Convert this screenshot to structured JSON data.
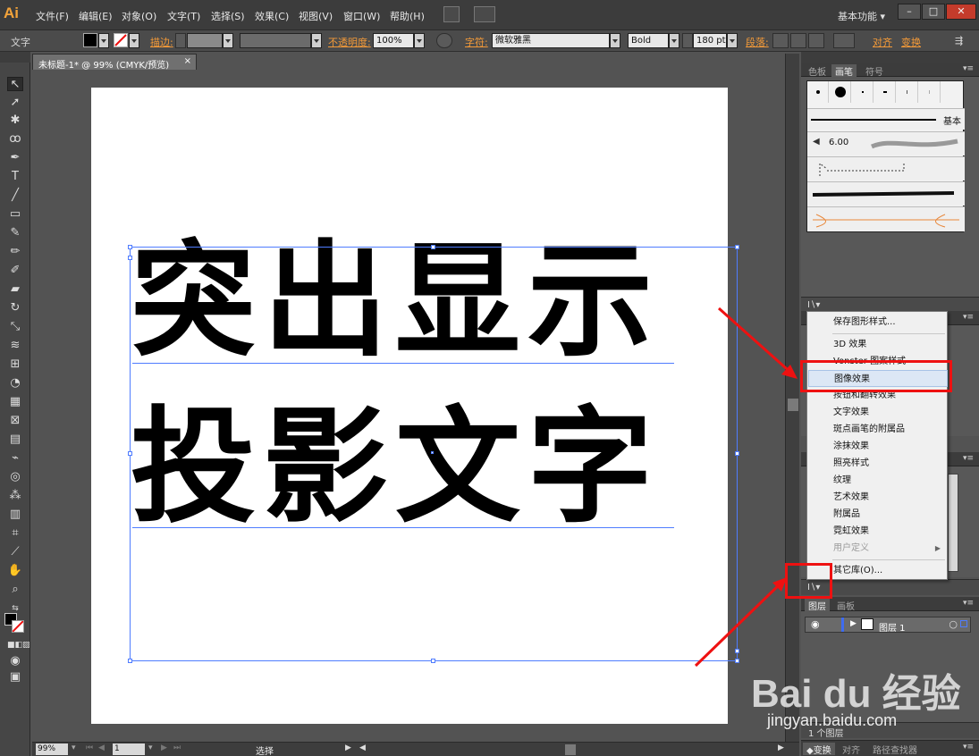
{
  "app": {
    "logo": "Ai",
    "workspace": "基本功能",
    "workspace_arrow": "▾"
  },
  "menu": [
    "文件(F)",
    "编辑(E)",
    "对象(O)",
    "文字(T)",
    "选择(S)",
    "效果(C)",
    "视图(V)",
    "窗口(W)",
    "帮助(H)"
  ],
  "window": {
    "min": "–",
    "restore": "□",
    "close": "✕"
  },
  "control_bar": {
    "tool_label": "文字",
    "stroke_label": "描边:",
    "opacity_label": "不透明度:",
    "opacity_value": "100%",
    "char_label": "字符:",
    "font_family": "微软雅黑",
    "font_style": "Bold",
    "font_size": "180 pt",
    "para_label": "段落:",
    "align_label": "对齐",
    "transform_label": "变换"
  },
  "document": {
    "tab_title": "未标题-1* @ 99% (CMYK/预览)",
    "tab_close": "×"
  },
  "canvas_text": {
    "line1": "突出显示",
    "line2": "投影文字"
  },
  "status": {
    "zoom": "99%",
    "page": "1",
    "mode": "选择"
  },
  "panels": {
    "top_tabs": [
      "色板",
      "画笔",
      "符号"
    ],
    "brush_basic": "基本",
    "brush_size": "6.00",
    "layers_tabs": [
      "图层",
      "画板"
    ],
    "layer_name": "图层 1",
    "layer_count": "1 个图层",
    "bottom_tabs": [
      "变换",
      "对齐",
      "路径查找器"
    ]
  },
  "graphic_style_menu": [
    {
      "label": "保存图形样式...",
      "disabled": false
    },
    {
      "label": "3D 效果",
      "disabled": false
    },
    {
      "label": "Vonster 图案样式",
      "disabled": false
    },
    {
      "label": "图像效果",
      "disabled": false,
      "highlight": true
    },
    {
      "label": "按钮和翻转效果",
      "disabled": false
    },
    {
      "label": "文字效果",
      "disabled": false
    },
    {
      "label": "斑点画笔的附属品",
      "disabled": false
    },
    {
      "label": "涂抹效果",
      "disabled": false
    },
    {
      "label": "照亮样式",
      "disabled": false
    },
    {
      "label": "纹理",
      "disabled": false
    },
    {
      "label": "艺术效果",
      "disabled": false
    },
    {
      "label": "附属品",
      "disabled": false
    },
    {
      "label": "霓虹效果",
      "disabled": false
    },
    {
      "label": "用户定义",
      "disabled": true,
      "submenu": true
    },
    {
      "label": "其它库(O)...",
      "disabled": false
    }
  ],
  "submenu_arrow": "▶",
  "watermark": {
    "logo": "Bai du 经验",
    "url": "jingyan.baidu.com"
  },
  "colors": {
    "accent": "#f39a39",
    "selection": "#4f7cff",
    "annotation": "#ee1111"
  }
}
